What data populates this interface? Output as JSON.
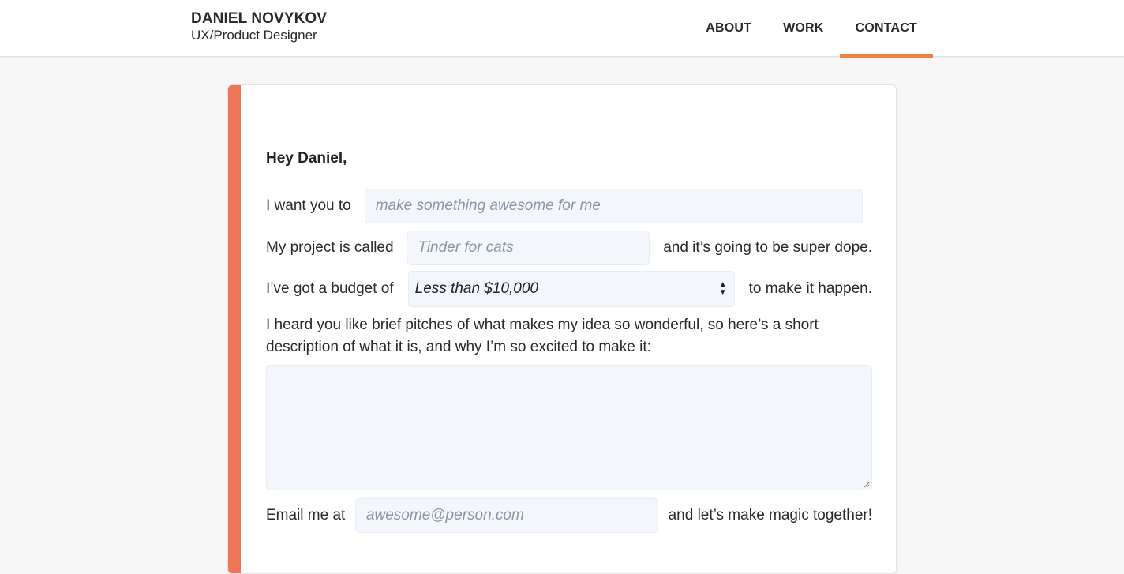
{
  "header": {
    "name": "DANIEL NOVYKOV",
    "role": "UX/Product Designer",
    "nav": [
      {
        "label": "ABOUT"
      },
      {
        "label": "WORK"
      },
      {
        "label": "CONTACT"
      }
    ],
    "active_nav": "CONTACT"
  },
  "form": {
    "greeting": "Hey Daniel,",
    "want_label": "I want you to",
    "want_placeholder": "make something awesome for me",
    "project_label": "My project is called",
    "project_placeholder": "Tinder for cats",
    "project_suffix": "and it’s going to be super dope.",
    "budget_label": "I’ve got a budget of",
    "budget_value": "Less than $10,000",
    "budget_suffix": "to make it happen.",
    "pitch_text": "I heard you like brief pitches of what makes my idea so wonderful, so here’s a short description of what it is, and why I’m so excited to make it:",
    "description_value": "",
    "email_label": "Email me at",
    "email_placeholder": "awesome@person.com",
    "email_suffix": "and let’s make magic together!"
  },
  "colors": {
    "accent_orange": "#f0823f",
    "card_accent": "#f07556",
    "field_bg": "#f3f6fb",
    "page_bg": "#f7f7f7"
  }
}
